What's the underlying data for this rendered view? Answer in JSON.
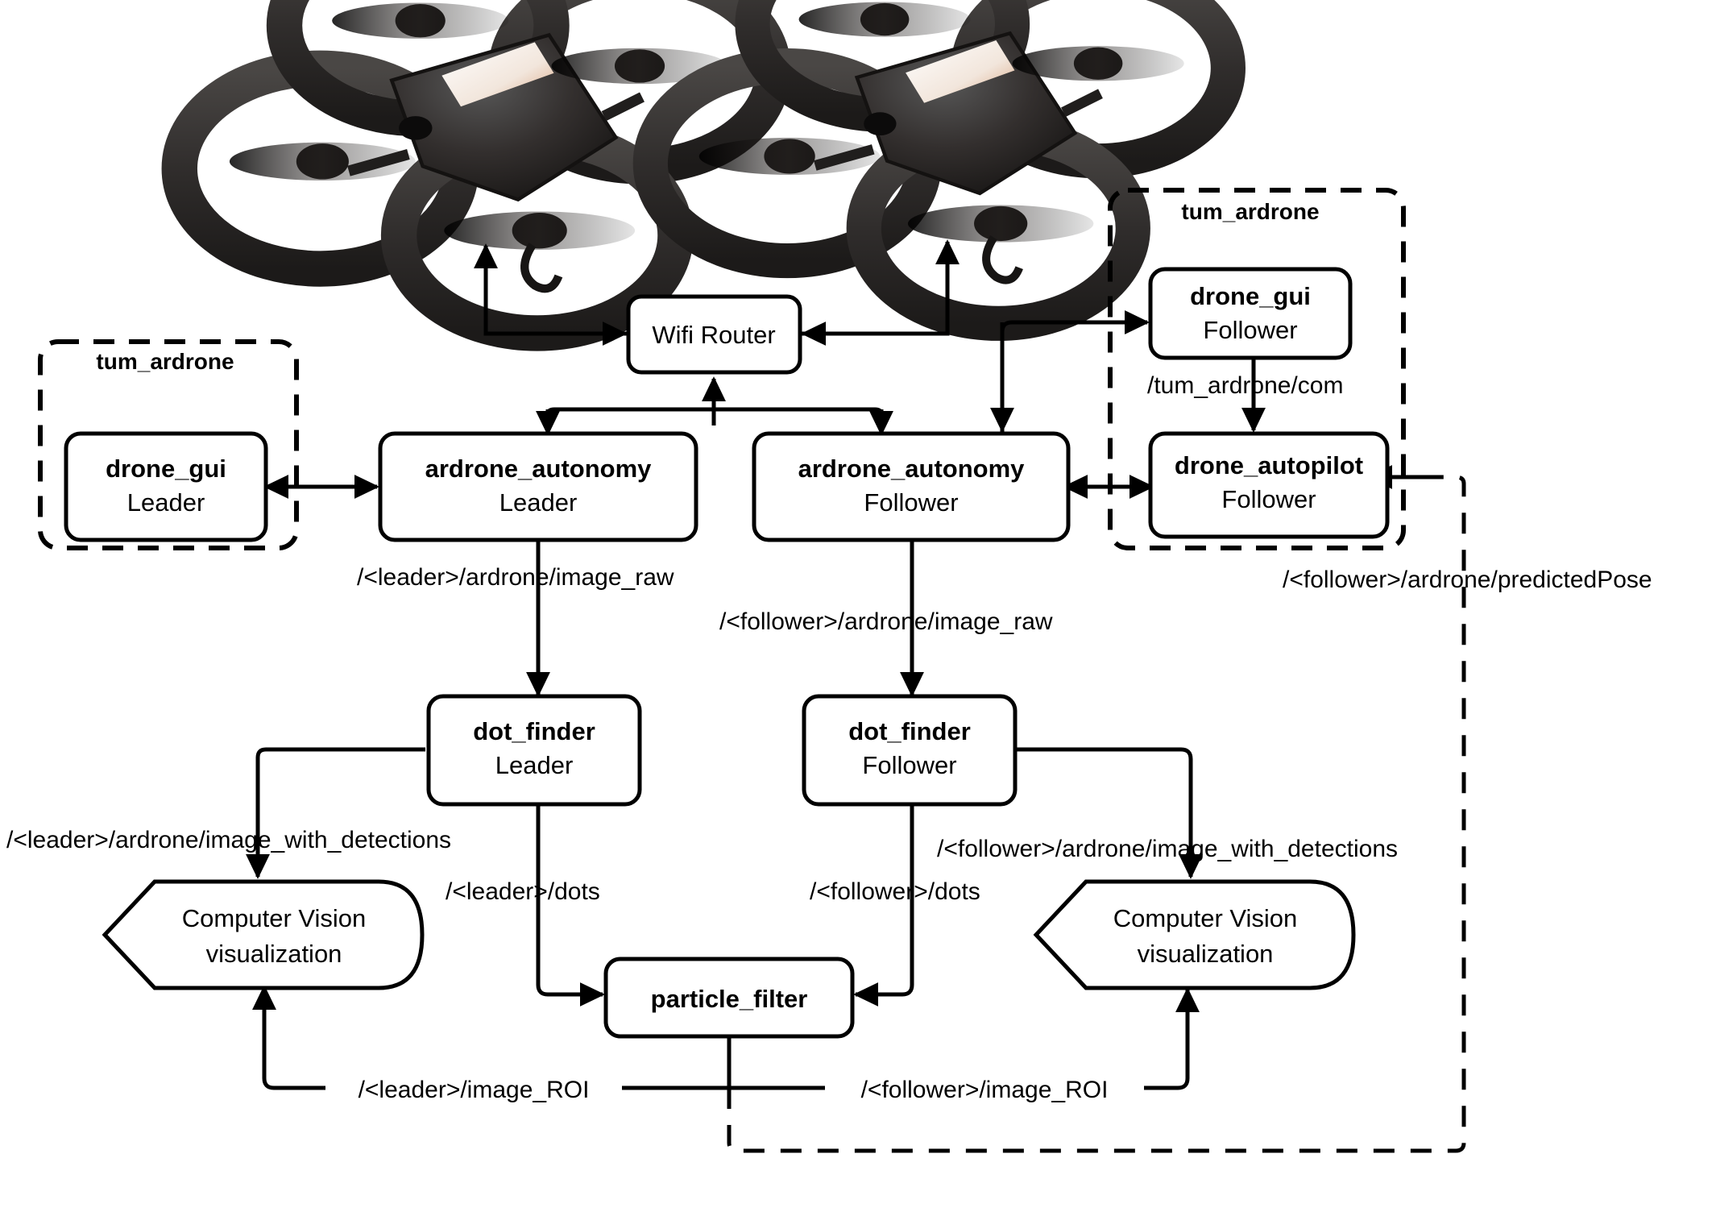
{
  "diagram": {
    "title": "Leader-Follower AR.Drone ROS node architecture",
    "colors": {
      "stroke": "#000000",
      "background": "#ffffff"
    },
    "hardware": [
      {
        "name": "drone-leader",
        "label": "AR.Drone Leader quadcopter photo"
      },
      {
        "name": "drone-follower",
        "label": "AR.Drone Follower quadcopter photo"
      }
    ],
    "groups": [
      {
        "id": "group_leader",
        "label": "tum_ardrone"
      },
      {
        "id": "group_follower",
        "label": "tum_ardrone"
      }
    ],
    "nodes": {
      "wifi_router": {
        "title": "Wifi Router",
        "subtitle": ""
      },
      "drone_gui_leader": {
        "title": "drone_gui",
        "subtitle": "Leader"
      },
      "drone_gui_follower": {
        "title": "drone_gui",
        "subtitle": "Follower"
      },
      "drone_autopilot_follower": {
        "title": "drone_autopilot",
        "subtitle": "Follower"
      },
      "ardrone_autonomy_leader": {
        "title": "ardrone_autonomy",
        "subtitle": "Leader"
      },
      "ardrone_autonomy_follower": {
        "title": "ardrone_autonomy",
        "subtitle": "Follower"
      },
      "dot_finder_leader": {
        "title": "dot_finder",
        "subtitle": "Leader"
      },
      "dot_finder_follower": {
        "title": "dot_finder",
        "subtitle": "Follower"
      },
      "particle_filter": {
        "title": "particle_filter",
        "subtitle": ""
      },
      "cv_viz_leader": {
        "line1": "Computer Vision",
        "line2": "visualization"
      },
      "cv_viz_follower": {
        "line1": "Computer Vision",
        "line2": "visualization"
      }
    },
    "topics": {
      "tum_ardrone_com": "/tum_ardrone/com",
      "leader_image_raw": "/<leader>/ardrone/image_raw",
      "follower_image_raw": "/<follower>/ardrone/image_raw",
      "follower_predicted_pose": "/<follower>/ardrone/predictedPose",
      "leader_image_with_detections": "/<leader>/ardrone/image_with_detections",
      "follower_image_with_detections": "/<follower>/ardrone/image_with_detections",
      "leader_dots": "/<leader>/dots",
      "follower_dots": "/<follower>/dots",
      "leader_image_roi": "/<leader>/image_ROI",
      "follower_image_roi": "/<follower>/image_ROI"
    }
  }
}
